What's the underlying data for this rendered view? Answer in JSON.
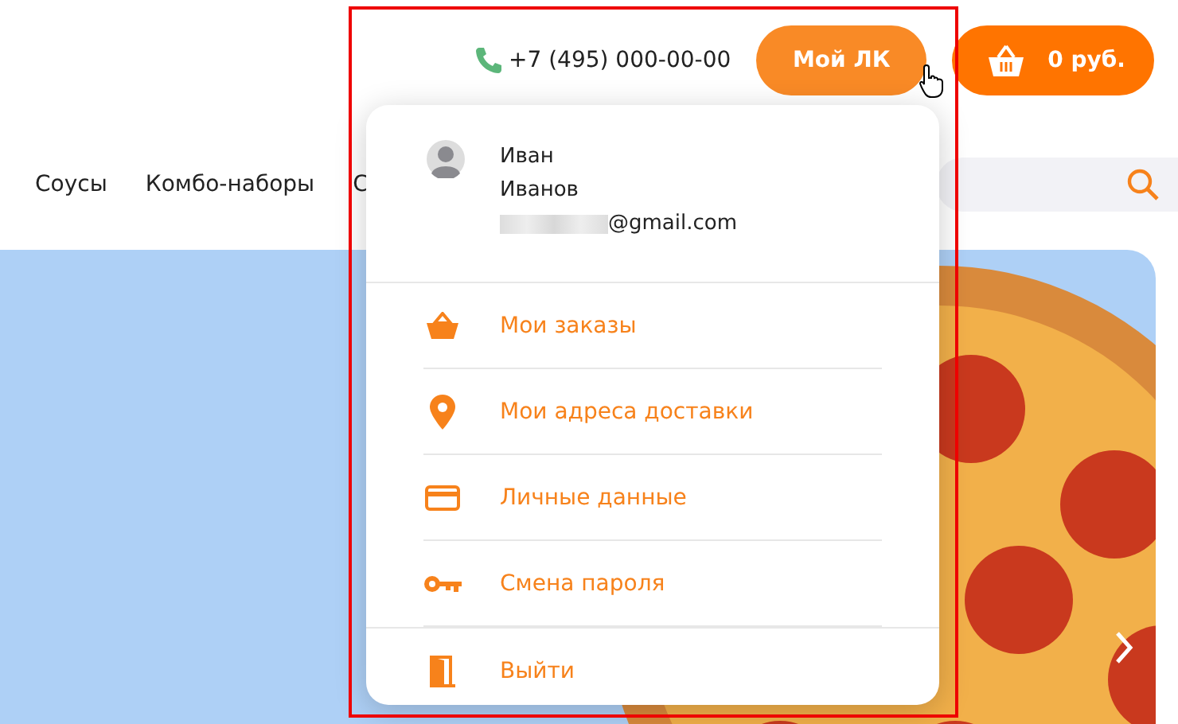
{
  "header": {
    "phone": "+7 (495) 000-00-00",
    "account_button": "Мой ЛК",
    "cart_total": "0 руб."
  },
  "nav": {
    "items": [
      "Соусы",
      "Комбо-наборы",
      "С"
    ]
  },
  "account_menu": {
    "user": {
      "first_name": "Иван",
      "last_name": "Иванов",
      "email": "@gmail.com"
    },
    "items": [
      {
        "kind": "orders",
        "label": "Мои заказы"
      },
      {
        "kind": "addresses",
        "label": "Мои адреса доставки"
      },
      {
        "kind": "profile",
        "label": "Личные данные"
      },
      {
        "kind": "password",
        "label": "Смена пароля"
      },
      {
        "kind": "logout",
        "label": "Выйти"
      }
    ]
  }
}
